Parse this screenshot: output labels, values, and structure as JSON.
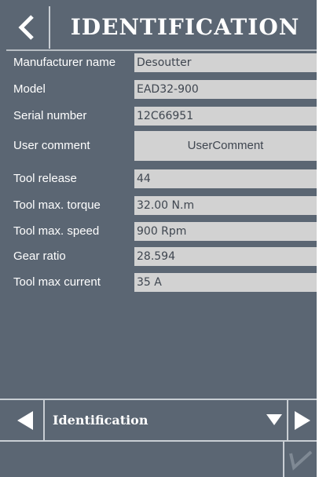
{
  "header": {
    "title": "IDENTIFICATION",
    "back_icon": "chevron-left-icon"
  },
  "fields": [
    {
      "label": "Manufacturer name",
      "value": "Desoutter"
    },
    {
      "label": "Model",
      "value": "EAD32-900"
    },
    {
      "label": "Serial number",
      "value": "12C66951"
    },
    {
      "label": "User comment",
      "value": "UserComment"
    },
    {
      "label": "Tool release",
      "value": "44"
    },
    {
      "label": "Tool max. torque",
      "value": "32.00 N.m"
    },
    {
      "label": "Tool max. speed",
      "value": "900 Rpm"
    },
    {
      "label": "Gear ratio",
      "value": "28.594"
    },
    {
      "label": "Tool max current",
      "value": "35 A"
    }
  ],
  "nav": {
    "selected_page": "Identification",
    "prev_icon": "triangle-left-icon",
    "next_icon": "triangle-right-icon",
    "dropdown_icon": "triangle-down-icon"
  },
  "footer": {
    "confirm_icon": "checkmark-icon"
  },
  "colors": {
    "background": "#5b6673",
    "field_background": "#d2d2d2",
    "text": "#ffffff",
    "field_text": "#3f4650",
    "separator": "#c9ced4",
    "confirm_disabled": "#7f8994"
  }
}
